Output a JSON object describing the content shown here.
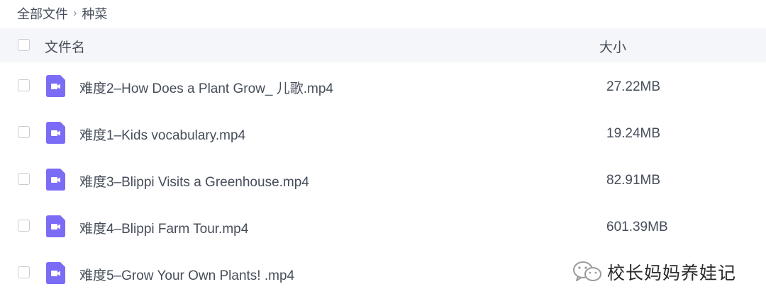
{
  "breadcrumb": {
    "root": "全部文件",
    "separator": "›",
    "current": "种菜"
  },
  "table": {
    "header": {
      "name_label": "文件名",
      "size_label": "大小"
    },
    "rows": [
      {
        "name": "难度2–How Does a Plant Grow_ 儿歌.mp4",
        "size": "27.22MB",
        "icon": "video-file-icon"
      },
      {
        "name": "难度1–Kids vocabulary.mp4",
        "size": "19.24MB",
        "icon": "video-file-icon"
      },
      {
        "name": "难度3–Blippi Visits a Greenhouse.mp4",
        "size": "82.91MB",
        "icon": "video-file-icon"
      },
      {
        "name": "难度4–Blippi Farm Tour.mp4",
        "size": "601.39MB",
        "icon": "video-file-icon"
      },
      {
        "name": "难度5–Grow Your Own Plants! .mp4",
        "size": "",
        "icon": "video-file-icon"
      }
    ]
  },
  "watermark": {
    "text": "校长妈妈养娃记",
    "icon": "wechat-icon"
  },
  "colors": {
    "icon_bg": "#7b6cf6",
    "header_bg": "#f5f6f9",
    "text": "#454d5a"
  }
}
